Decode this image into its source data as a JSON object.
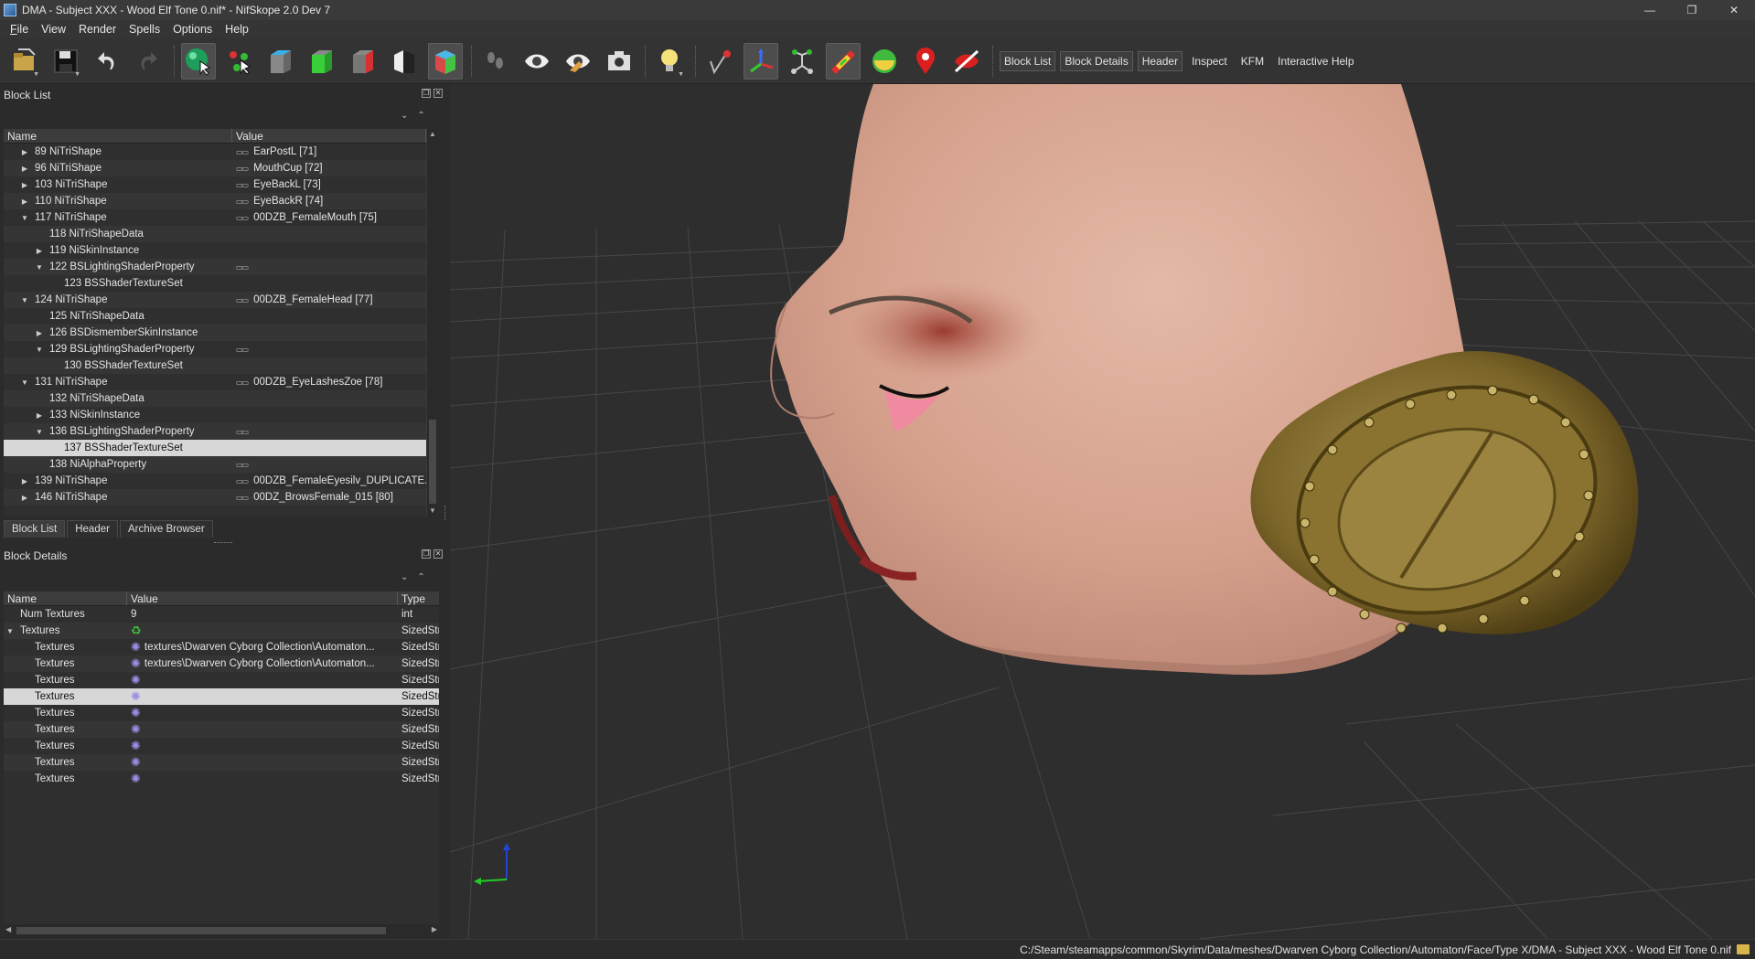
{
  "window": {
    "title": "DMA - Subject XXX - Wood Elf Tone 0.nif* - NifSkope 2.0 Dev 7",
    "minimize": "—",
    "restore": "❐",
    "close": "✕"
  },
  "menu": [
    "File",
    "View",
    "Render",
    "Spells",
    "Options",
    "Help"
  ],
  "toolbar": {
    "icons": [
      "open-file-icon",
      "save-icon",
      "undo-icon",
      "redo-icon",
      "select-object-icon",
      "select-vertex-icon",
      "view-top-icon",
      "view-front-icon",
      "view-side-icon",
      "view-flip-icon",
      "view-perspective-icon",
      "walk-mode-icon",
      "view-visibility-icon",
      "hidden-visibility-icon",
      "screenshot-icon",
      "light-icon",
      "nodes-icon",
      "axes-icon",
      "constraints-icon",
      "textures-icon",
      "colors-icon",
      "markers-icon",
      "hide-icon"
    ],
    "text_buttons": [
      "Block List",
      "Block Details",
      "Header",
      "Inspect",
      "KFM",
      "Interactive Help"
    ]
  },
  "block_list": {
    "title": "Block List",
    "columns": [
      "Name",
      "Value"
    ],
    "rows": [
      {
        "depth": 0,
        "arrow": "▶",
        "name": "89 NiTriShape",
        "link": true,
        "value": "EarPostL [71]"
      },
      {
        "depth": 0,
        "arrow": "▶",
        "name": "96 NiTriShape",
        "link": true,
        "value": "MouthCup [72]"
      },
      {
        "depth": 0,
        "arrow": "▶",
        "name": "103 NiTriShape",
        "link": true,
        "value": "EyeBackL [73]"
      },
      {
        "depth": 0,
        "arrow": "▶",
        "name": "110 NiTriShape",
        "link": true,
        "value": "EyeBackR [74]"
      },
      {
        "depth": 0,
        "arrow": "▼",
        "name": "117 NiTriShape",
        "link": true,
        "value": "00DZB_FemaleMouth [75]"
      },
      {
        "depth": 1,
        "arrow": "",
        "name": "118 NiTriShapeData",
        "link": false,
        "value": ""
      },
      {
        "depth": 1,
        "arrow": "▶",
        "name": "119 NiSkinInstance",
        "link": false,
        "value": ""
      },
      {
        "depth": 1,
        "arrow": "▼",
        "name": "122 BSLightingShaderProperty",
        "link": true,
        "value": ""
      },
      {
        "depth": 2,
        "arrow": "",
        "name": "123 BSShaderTextureSet",
        "link": false,
        "value": ""
      },
      {
        "depth": 0,
        "arrow": "▼",
        "name": "124 NiTriShape",
        "link": true,
        "value": "00DZB_FemaleHead [77]"
      },
      {
        "depth": 1,
        "arrow": "",
        "name": "125 NiTriShapeData",
        "link": false,
        "value": ""
      },
      {
        "depth": 1,
        "arrow": "▶",
        "name": "126 BSDismemberSkinInstance",
        "link": false,
        "value": ""
      },
      {
        "depth": 1,
        "arrow": "▼",
        "name": "129 BSLightingShaderProperty",
        "link": true,
        "value": ""
      },
      {
        "depth": 2,
        "arrow": "",
        "name": "130 BSShaderTextureSet",
        "link": false,
        "value": ""
      },
      {
        "depth": 0,
        "arrow": "▼",
        "name": "131 NiTriShape",
        "link": true,
        "value": "00DZB_EyeLashesZoe [78]"
      },
      {
        "depth": 1,
        "arrow": "",
        "name": "132 NiTriShapeData",
        "link": false,
        "value": ""
      },
      {
        "depth": 1,
        "arrow": "▶",
        "name": "133 NiSkinInstance",
        "link": false,
        "value": ""
      },
      {
        "depth": 1,
        "arrow": "▼",
        "name": "136 BSLightingShaderProperty",
        "link": true,
        "value": ""
      },
      {
        "depth": 2,
        "arrow": "",
        "name": "137 BSShaderTextureSet",
        "link": false,
        "value": "",
        "selected": true
      },
      {
        "depth": 1,
        "arrow": "",
        "name": "138 NiAlphaProperty",
        "link": true,
        "value": ""
      },
      {
        "depth": 0,
        "arrow": "▶",
        "name": "139 NiTriShape",
        "link": true,
        "value": "00DZB_FemaleEyesilv_DUPLICATE..."
      },
      {
        "depth": 0,
        "arrow": "▶",
        "name": "146 NiTriShape",
        "link": true,
        "value": "00DZ_BrowsFemale_015 [80]"
      }
    ]
  },
  "tabs": [
    "Block List",
    "Header",
    "Archive Browser"
  ],
  "block_details": {
    "title": "Block Details",
    "columns": [
      "Name",
      "Value",
      "Type"
    ],
    "rows": [
      {
        "arrow": "",
        "indent": 1,
        "name": "Num Textures",
        "icon": "",
        "value": "9",
        "type": "int"
      },
      {
        "arrow": "▼",
        "indent": 0,
        "name": "Textures",
        "icon": "refresh",
        "value": "",
        "type": "SizedStri"
      },
      {
        "arrow": "",
        "indent": 2,
        "name": "Textures",
        "icon": "gear",
        "value": "textures\\Dwarven Cyborg Collection\\Automaton...",
        "type": "SizedStri"
      },
      {
        "arrow": "",
        "indent": 2,
        "name": "Textures",
        "icon": "gear",
        "value": "textures\\Dwarven Cyborg Collection\\Automaton...",
        "type": "SizedStri"
      },
      {
        "arrow": "",
        "indent": 2,
        "name": "Textures",
        "icon": "gear",
        "value": "",
        "type": "SizedStri"
      },
      {
        "arrow": "",
        "indent": 2,
        "name": "Textures",
        "icon": "gear",
        "value": "",
        "type": "SizedStri",
        "selected": true
      },
      {
        "arrow": "",
        "indent": 2,
        "name": "Textures",
        "icon": "gear",
        "value": "",
        "type": "SizedStri"
      },
      {
        "arrow": "",
        "indent": 2,
        "name": "Textures",
        "icon": "gear",
        "value": "",
        "type": "SizedStri"
      },
      {
        "arrow": "",
        "indent": 2,
        "name": "Textures",
        "icon": "gear",
        "value": "",
        "type": "SizedStri"
      },
      {
        "arrow": "",
        "indent": 2,
        "name": "Textures",
        "icon": "gear",
        "value": "",
        "type": "SizedStri"
      },
      {
        "arrow": "",
        "indent": 2,
        "name": "Textures",
        "icon": "gear",
        "value": "",
        "type": "SizedStri"
      }
    ]
  },
  "status": {
    "path": "C:/Steam/steamapps/common/Skyrim/Data/meshes/Dwarven Cyborg Collection/Automaton/Face/Type X/DMA - Subject XXX - Wood Elf Tone 0.nif"
  },
  "colors": {
    "viewport_bg": "#2e2e2e",
    "grid_line": "#474747",
    "skin": "#d8a896",
    "brass": "#8a7330",
    "axis_x": "#22cc22",
    "axis_y": "#2244dd"
  }
}
